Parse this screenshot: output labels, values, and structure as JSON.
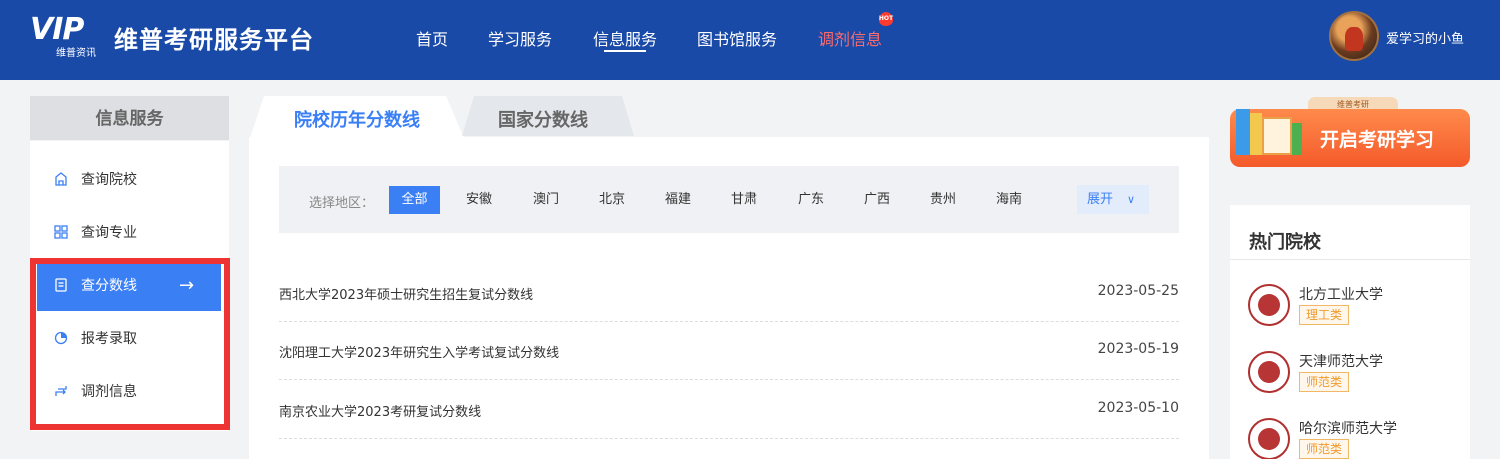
{
  "header": {
    "logo_text": "VIP",
    "logo_sub": "维普资讯",
    "brand": "维普考研服务平台",
    "nav": [
      {
        "label": "首页"
      },
      {
        "label": "学习服务"
      },
      {
        "label": "信息服务"
      },
      {
        "label": "图书馆服务"
      },
      {
        "label": "调剂信息"
      }
    ],
    "active_nav": "信息服务",
    "hot_badge": "HOT",
    "username": "爱学习的小鱼"
  },
  "sidebar": {
    "title": "信息服务",
    "items": [
      {
        "label": "查询院校",
        "icon": "school-icon"
      },
      {
        "label": "查询专业",
        "icon": "grid-icon"
      },
      {
        "label": "查分数线",
        "icon": "score-icon",
        "active": true
      },
      {
        "label": "报考录取",
        "icon": "pie-chart-icon"
      },
      {
        "label": "调剂信息",
        "icon": "swap-icon"
      }
    ],
    "active_arrow": "→"
  },
  "tabs": [
    {
      "label": "院校历年分数线",
      "active": true
    },
    {
      "label": "国家分数线",
      "active": false
    }
  ],
  "filter": {
    "label": "选择地区：",
    "regions": [
      "全部",
      "安徽",
      "澳门",
      "北京",
      "福建",
      "甘肃",
      "广东",
      "广西",
      "贵州",
      "海南"
    ],
    "selected": "全部",
    "expand_label": "展开",
    "expand_icon": "∨"
  },
  "news": [
    {
      "title": "西北大学2023年硕士研究生招生复试分数线",
      "date": "2023-05-25"
    },
    {
      "title": "沈阳理工大学2023年研究生入学考试复试分数线",
      "date": "2023-05-19"
    },
    {
      "title": "南京农业大学2023考研复试分数线",
      "date": "2023-05-10"
    }
  ],
  "banner": {
    "tag": "维普考研",
    "text": "开启考研学习"
  },
  "hot_schools": {
    "title": "热门院校",
    "items": [
      {
        "name": "北方工业大学",
        "category": "理工类"
      },
      {
        "name": "天津师范大学",
        "category": "师范类"
      },
      {
        "name": "哈尔滨师范大学",
        "category": "师范类"
      }
    ]
  },
  "colors": {
    "header_bg": "#1a4aa8",
    "accent": "#3b7ff5",
    "highlight_border": "#ee3333",
    "hot_nav": "#ff6a6a",
    "category_tag": "#f09a2b"
  }
}
